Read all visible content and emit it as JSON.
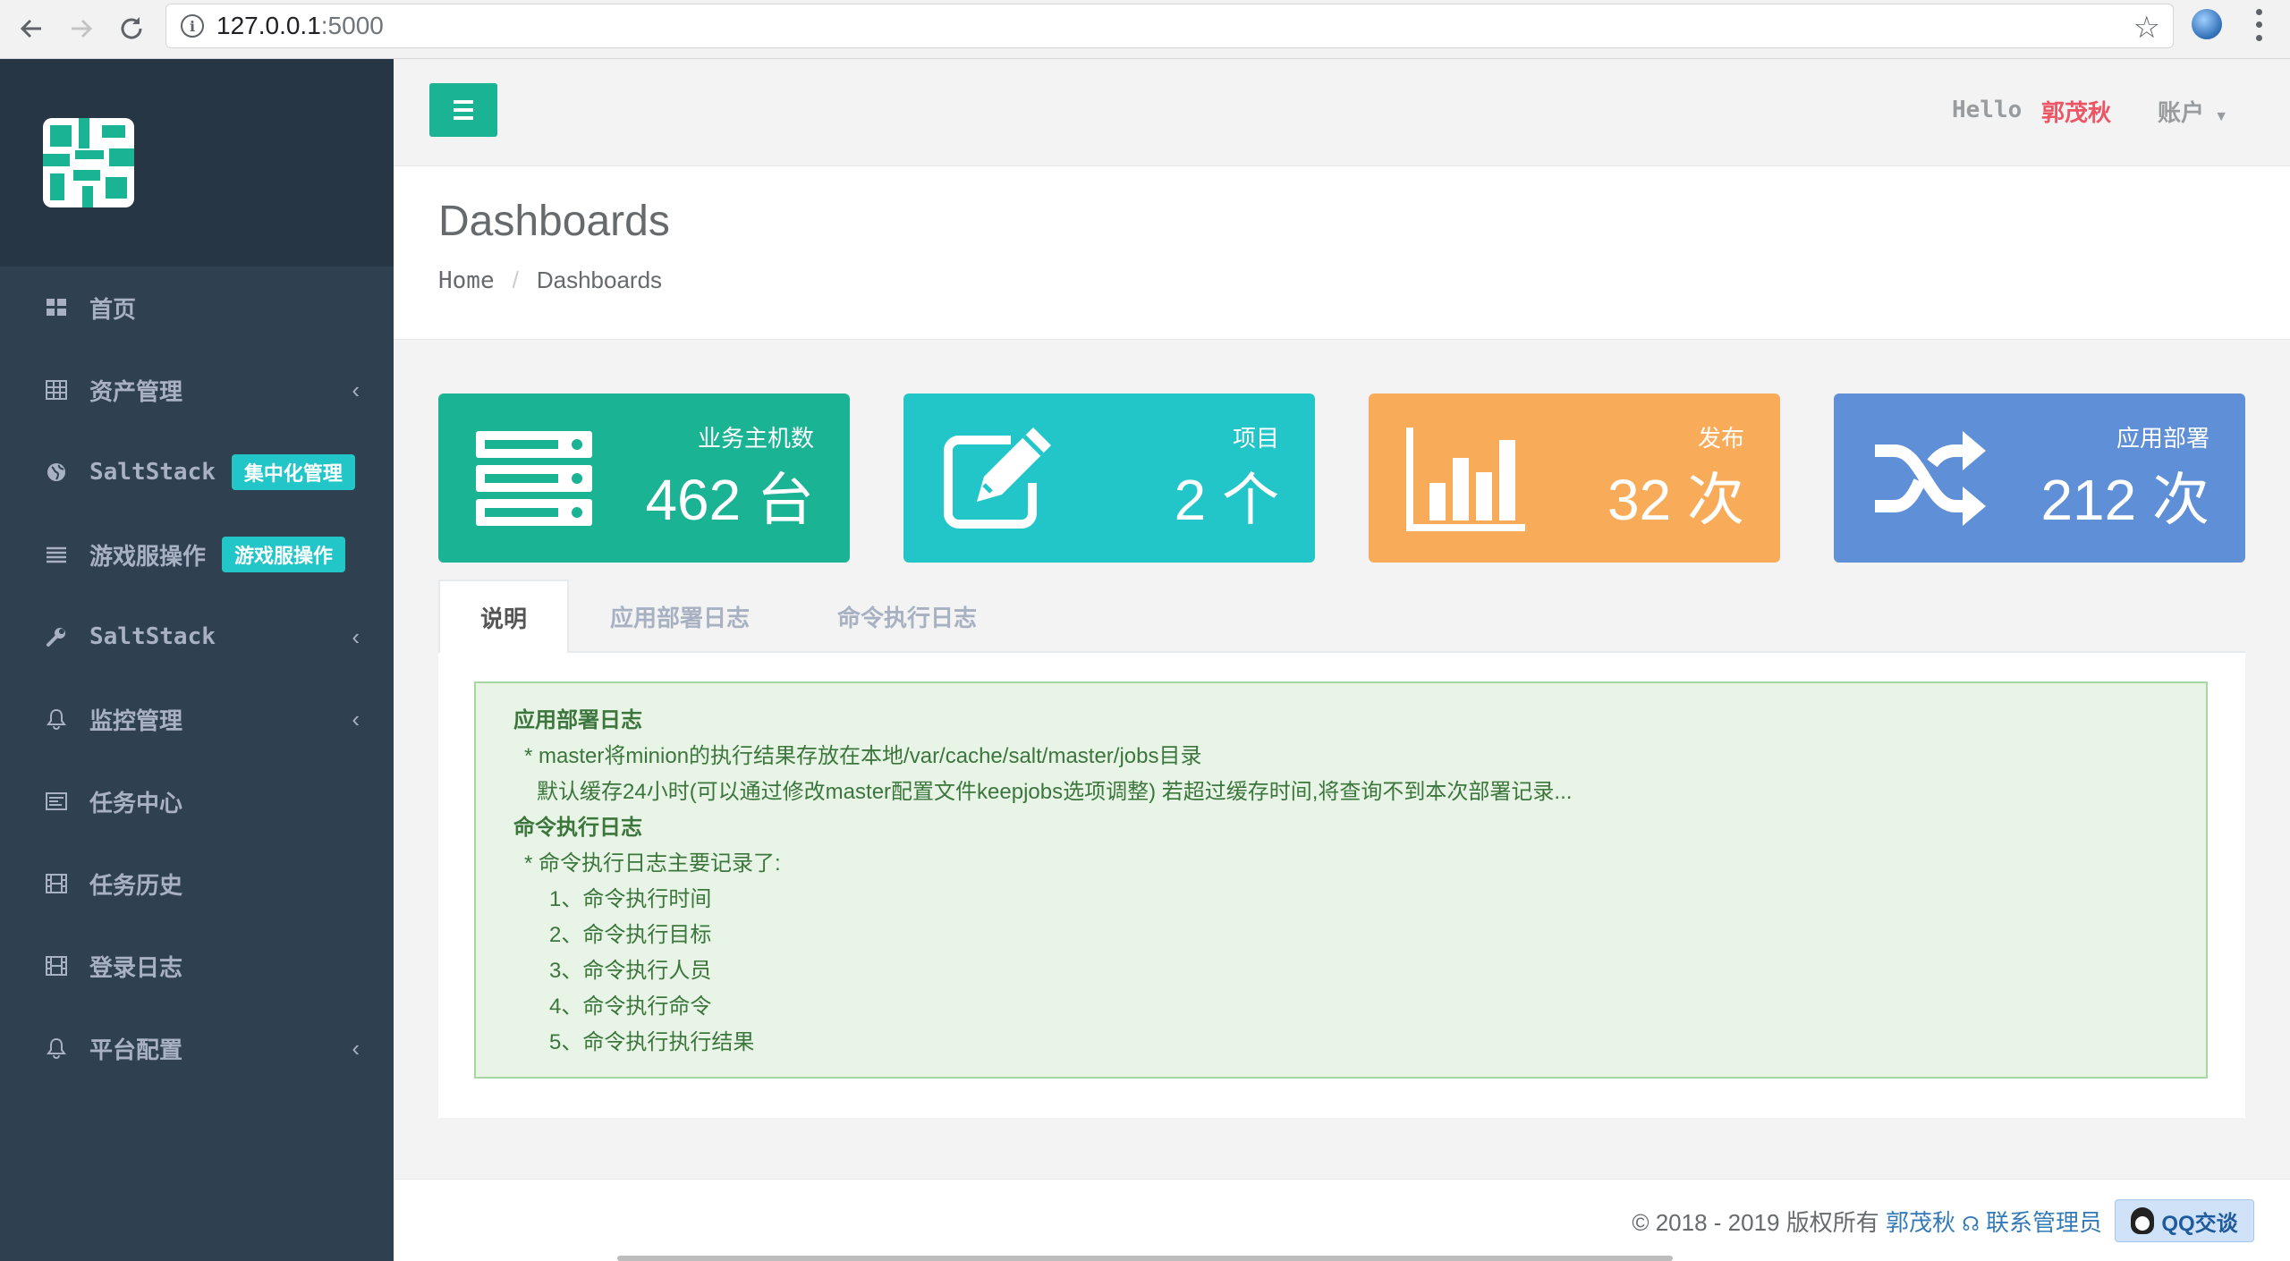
{
  "browser": {
    "url_host": "127.0.0.1",
    "url_port": ":5000"
  },
  "sidebar": {
    "items": [
      {
        "label": "首页",
        "icon": "dashboard-icon"
      },
      {
        "label": "资产管理",
        "icon": "table-icon",
        "has_arrow": true
      },
      {
        "label": "SaltStack",
        "icon": "globe-icon",
        "badge": "集中化管理"
      },
      {
        "label": "游戏服操作",
        "icon": "list-icon",
        "badge": "游戏服操作"
      },
      {
        "label": "SaltStack",
        "icon": "wrench-icon",
        "has_arrow": true
      },
      {
        "label": "监控管理",
        "icon": "bell-icon",
        "has_arrow": true
      },
      {
        "label": "任务中心",
        "icon": "tasks-icon"
      },
      {
        "label": "任务历史",
        "icon": "film-icon"
      },
      {
        "label": "登录日志",
        "icon": "film-icon"
      },
      {
        "label": "平台配置",
        "icon": "bell-icon",
        "has_arrow": true
      }
    ],
    "arrow_glyph": "‹"
  },
  "topbar": {
    "hello": "Hello",
    "username": "郭茂秋",
    "account": "账户"
  },
  "heading": {
    "title": "Dashboards",
    "breadcrumb_home": "Home",
    "breadcrumb_sep": "/",
    "breadcrumb_current": "Dashboards"
  },
  "stats": [
    {
      "label": "业务主机数",
      "value": "462 台",
      "color": "#1ab394",
      "icon": "server-icon"
    },
    {
      "label": "项目",
      "value": "2 个",
      "color": "#23c6c8",
      "icon": "edit-icon"
    },
    {
      "label": "发布",
      "value": "32 次",
      "color": "#f8ac59",
      "icon": "bar-chart-icon"
    },
    {
      "label": "应用部署",
      "value": "212 次",
      "color": "#5f8fd6",
      "icon": "random-icon"
    }
  ],
  "tabs": [
    "说明",
    "应用部署日志",
    "命令执行日志"
  ],
  "alert": {
    "lines": [
      "应用部署日志",
      "* master将minion的执行结果存放在本地/var/cache/salt/master/jobs目录",
      "默认缓存24小时(可以通过修改master配置文件keepjobs选项调整) 若超过缓存时间,将查询不到本次部署记录...",
      "命令执行日志",
      "* 命令执行日志主要记录了:",
      "1、命令执行时间",
      "2、命令执行目标",
      "3、命令执行人员",
      "4、命令执行命令",
      "5、命令执行执行结果"
    ]
  },
  "footer": {
    "copyright": "© 2018 - 2019 版权所有",
    "author": "郭茂秋",
    "contact": "联系管理员",
    "qq_button": "QQ交谈"
  }
}
